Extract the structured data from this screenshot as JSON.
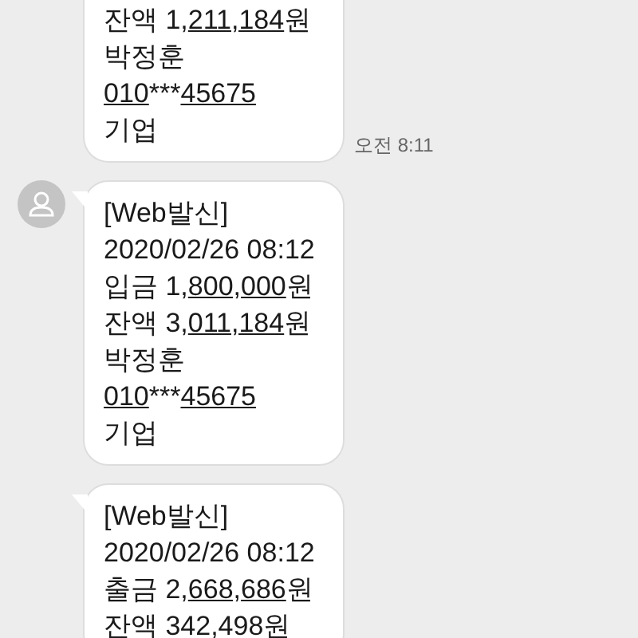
{
  "messages": [
    {
      "avatar": false,
      "tail": false,
      "cut_top": true,
      "lines": [
        [
          {
            "text": "잔액 1,",
            "linked": false
          },
          {
            "text": "211,184",
            "linked": true
          },
          {
            "text": "원",
            "linked": false
          }
        ],
        [
          {
            "text": "박정훈",
            "linked": false
          }
        ],
        [
          {
            "text": "010",
            "linked": true
          },
          {
            "text": "***",
            "linked": false
          },
          {
            "text": "45675",
            "linked": true
          }
        ],
        [
          {
            "text": "기업",
            "linked": false
          }
        ]
      ],
      "time": "오전 8:11"
    },
    {
      "avatar": true,
      "tail": true,
      "cut_top": false,
      "lines": [
        [
          {
            "text": "[Web발신]",
            "linked": false
          }
        ],
        [
          {
            "text": "2020/02/26 08:12",
            "linked": false
          }
        ],
        [
          {
            "text": "입금 1,",
            "linked": false
          },
          {
            "text": "800,000",
            "linked": true
          },
          {
            "text": "원",
            "linked": false
          }
        ],
        [
          {
            "text": "잔액 3,",
            "linked": false
          },
          {
            "text": "011,184",
            "linked": true
          },
          {
            "text": "원",
            "linked": false
          }
        ],
        [
          {
            "text": "박정훈",
            "linked": false
          }
        ],
        [
          {
            "text": "010",
            "linked": true
          },
          {
            "text": "***",
            "linked": false
          },
          {
            "text": "45675",
            "linked": true
          }
        ],
        [
          {
            "text": "기업",
            "linked": false
          }
        ]
      ]
    },
    {
      "avatar": false,
      "tail": true,
      "cut_top": false,
      "lines": [
        [
          {
            "text": "[Web발신]",
            "linked": false
          }
        ],
        [
          {
            "text": "2020/02/26 08:12",
            "linked": false
          }
        ],
        [
          {
            "text": "출금 2,",
            "linked": false
          },
          {
            "text": "668,686",
            "linked": true
          },
          {
            "text": "원",
            "linked": false
          }
        ],
        [
          {
            "text": "잔액 342,498원",
            "linked": false
          }
        ]
      ]
    }
  ]
}
